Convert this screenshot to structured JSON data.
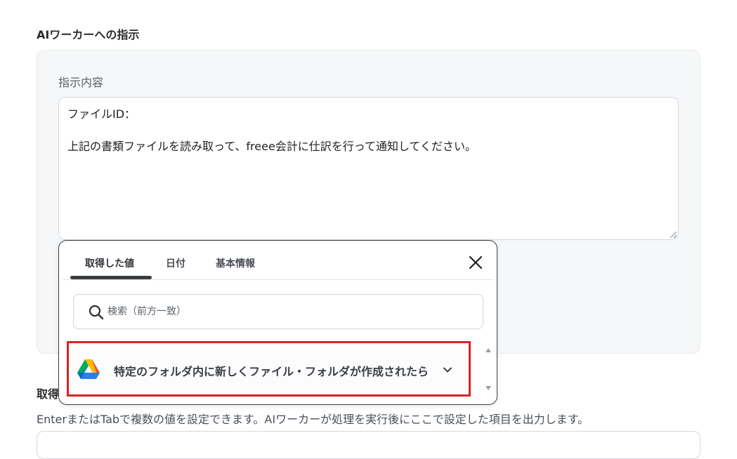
{
  "section": {
    "title": "AIワーカーへの指示"
  },
  "instruction": {
    "label": "指示内容",
    "line1": "ファイルID：",
    "line2": "上記の書類ファイルを読み取って、freee会計に仕訳を行って通知してください。"
  },
  "output": {
    "title": "取得",
    "description": "EnterまたはTabで複数の値を設定できます。AIワーカーが処理を実行後にここで設定した項目を出力します。"
  },
  "popup": {
    "tabs": [
      {
        "label": "取得した値"
      },
      {
        "label": "日付"
      },
      {
        "label": "基本情報"
      }
    ],
    "search": {
      "placeholder": "検索（前方一致）"
    },
    "items": [
      {
        "label": "特定のフォルダ内に新しくファイル・フォルダが作成されたら",
        "icon": "google-drive-icon"
      }
    ]
  },
  "colors": {
    "highlight_border": "#d92323",
    "panel_bg": "#f6f7f8",
    "tab_underline": "#3a3d42"
  }
}
